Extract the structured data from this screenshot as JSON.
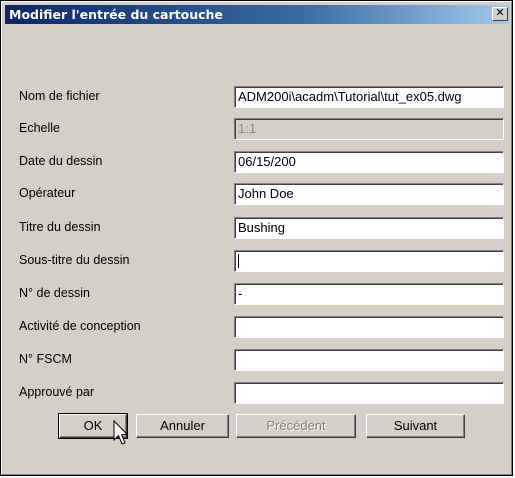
{
  "dialog": {
    "title": "Modifier l'entrée du cartouche",
    "close_glyph": "✕"
  },
  "fields": [
    {
      "label": "Nom de fichier",
      "value": "ADM200i\\acadm\\Tutorial\\tut_ex05.dwg",
      "enabled": true
    },
    {
      "label": "Echelle",
      "value": "1:1",
      "enabled": false
    },
    {
      "label": "Date du dessin",
      "value": "06/15/200",
      "enabled": true
    },
    {
      "label": "Opérateur",
      "value": "John Doe",
      "enabled": true
    },
    {
      "label": "Titre du dessin",
      "value": "Bushing",
      "enabled": true
    },
    {
      "label": "Sous-titre du dessin",
      "value": "",
      "enabled": true,
      "focused": true
    },
    {
      "label": "N° de dessin",
      "value": "-",
      "enabled": true
    },
    {
      "label": "Activité de conception",
      "value": "",
      "enabled": true
    },
    {
      "label": "N° FSCM",
      "value": "",
      "enabled": true
    },
    {
      "label": "Approuvé par",
      "value": "",
      "enabled": true
    }
  ],
  "buttons": {
    "ok": "OK",
    "cancel": "Annuler",
    "previous": "Précédent",
    "next": "Suivant"
  },
  "icons": {
    "close": "close-icon",
    "cursor": "mouse-pointer-icon"
  },
  "colors": {
    "titlebar_start": "#0a246a",
    "titlebar_end": "#a6caf0",
    "face": "#d4d0c8"
  }
}
